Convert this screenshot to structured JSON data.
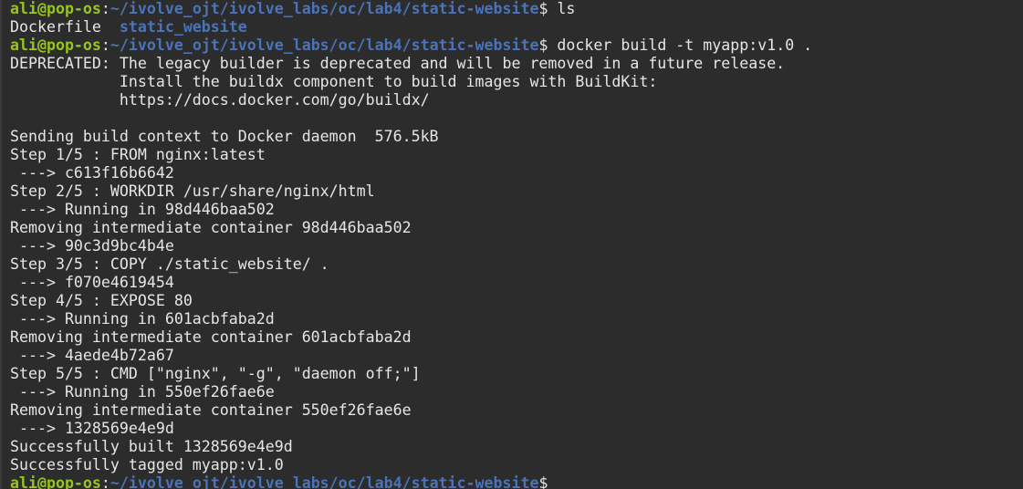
{
  "terminal": {
    "colors": {
      "background": "#2c2c2c",
      "foreground": "#e6e6e6",
      "prompt_user": "#97c41d",
      "prompt_path": "#4a73b8",
      "directory": "#4a73b8"
    },
    "lines": [
      [
        {
          "t": "ali@pop-os",
          "k": "prompt_user"
        },
        {
          "t": ":",
          "k": "prompt_sep"
        },
        {
          "t": "~/ivolve_ojt/ivolve_labs/oc/lab4/static-website",
          "k": "prompt_path"
        },
        {
          "t": "$ ls",
          "k": "text"
        }
      ],
      [
        {
          "t": "Dockerfile  ",
          "k": "text"
        },
        {
          "t": "static_website",
          "k": "dir"
        }
      ],
      [
        {
          "t": "ali@pop-os",
          "k": "prompt_user"
        },
        {
          "t": ":",
          "k": "prompt_sep"
        },
        {
          "t": "~/ivolve_ojt/ivolve_labs/oc/lab4/static-website",
          "k": "prompt_path"
        },
        {
          "t": "$ docker build -t myapp:v1.0 .",
          "k": "text"
        }
      ],
      [
        {
          "t": "DEPRECATED: The legacy builder is deprecated and will be removed in a future release.",
          "k": "text"
        }
      ],
      [
        {
          "t": "            Install the buildx component to build images with BuildKit:",
          "k": "text"
        }
      ],
      [
        {
          "t": "            https://docs.docker.com/go/buildx/",
          "k": "text"
        }
      ],
      [
        {
          "t": "",
          "k": "text"
        }
      ],
      [
        {
          "t": "Sending build context to Docker daemon  576.5kB",
          "k": "text"
        }
      ],
      [
        {
          "t": "Step 1/5 : FROM nginx:latest",
          "k": "text"
        }
      ],
      [
        {
          "t": " ---> c613f16b6642",
          "k": "text"
        }
      ],
      [
        {
          "t": "Step 2/5 : WORKDIR /usr/share/nginx/html",
          "k": "text"
        }
      ],
      [
        {
          "t": " ---> Running in 98d446baa502",
          "k": "text"
        }
      ],
      [
        {
          "t": "Removing intermediate container 98d446baa502",
          "k": "text"
        }
      ],
      [
        {
          "t": " ---> 90c3d9bc4b4e",
          "k": "text"
        }
      ],
      [
        {
          "t": "Step 3/5 : COPY ./static_website/ .",
          "k": "text"
        }
      ],
      [
        {
          "t": " ---> f070e4619454",
          "k": "text"
        }
      ],
      [
        {
          "t": "Step 4/5 : EXPOSE 80",
          "k": "text"
        }
      ],
      [
        {
          "t": " ---> Running in 601acbfaba2d",
          "k": "text"
        }
      ],
      [
        {
          "t": "Removing intermediate container 601acbfaba2d",
          "k": "text"
        }
      ],
      [
        {
          "t": " ---> 4aede4b72a67",
          "k": "text"
        }
      ],
      [
        {
          "t": "Step 5/5 : CMD [\"nginx\", \"-g\", \"daemon off;\"]",
          "k": "text"
        }
      ],
      [
        {
          "t": " ---> Running in 550ef26fae6e",
          "k": "text"
        }
      ],
      [
        {
          "t": "Removing intermediate container 550ef26fae6e",
          "k": "text"
        }
      ],
      [
        {
          "t": " ---> 1328569e4e9d",
          "k": "text"
        }
      ],
      [
        {
          "t": "Successfully built 1328569e4e9d",
          "k": "text"
        }
      ],
      [
        {
          "t": "Successfully tagged myapp:v1.0",
          "k": "text"
        }
      ],
      [
        {
          "t": "ali@pop-os",
          "k": "prompt_user"
        },
        {
          "t": ":",
          "k": "prompt_sep"
        },
        {
          "t": "~/ivolve_ojt/ivolve_labs/oc/lab4/static-website",
          "k": "prompt_path"
        },
        {
          "t": "$",
          "k": "text"
        }
      ]
    ]
  }
}
